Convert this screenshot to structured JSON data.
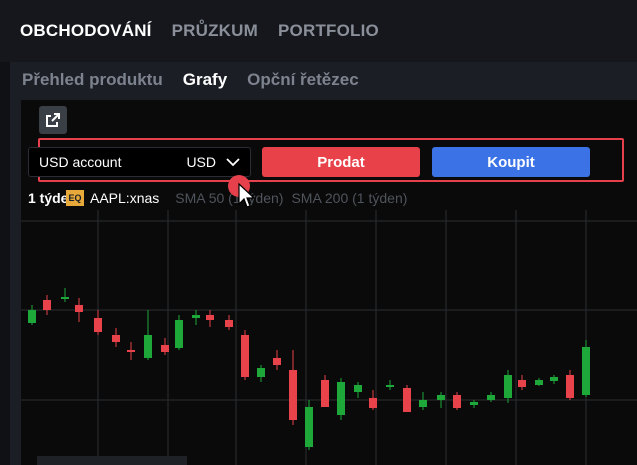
{
  "topnav": {
    "items": [
      {
        "label": "OBCHODOVÁNÍ",
        "active": true
      },
      {
        "label": "PRŮZKUM",
        "active": false
      },
      {
        "label": "PORTFOLIO",
        "active": false
      }
    ]
  },
  "subtabs": {
    "items": [
      {
        "label": "Přehled produktu",
        "active": false
      },
      {
        "label": "Grafy",
        "active": true
      },
      {
        "label": "Opční řetězec",
        "active": false
      }
    ]
  },
  "toolbar": {
    "external_icon": "external-link-icon"
  },
  "trade": {
    "account_label": "USD account",
    "currency": "USD",
    "sell_label": "Prodat",
    "buy_label": "Koupit"
  },
  "legend": {
    "timeframe": "1 týden",
    "badge": "EQ",
    "symbol": "AAPL:xnas",
    "sma50": "SMA 50 (1 týden)",
    "sma200": "SMA 200 (1 týden)"
  },
  "colors": {
    "up": "#1fa83a",
    "down": "#e8434b",
    "accent_red": "#e5404b",
    "buy_blue": "#3b73e7"
  },
  "chart_data": {
    "type": "candlestick",
    "candles": [
      {
        "o": 1,
        "c": 0
      },
      {
        "o": 0.0,
        "c": 0.0
      },
      {
        "o": 0.0,
        "c": 0.0
      }
    ]
  }
}
